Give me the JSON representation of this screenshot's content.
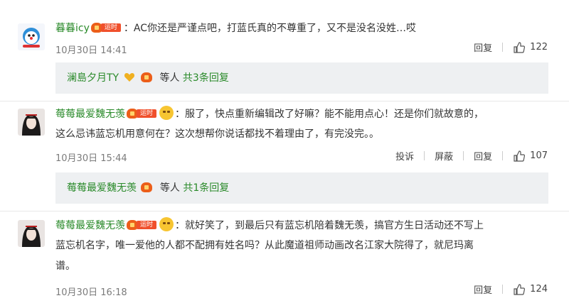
{
  "comments": [
    {
      "username": "暮暮icy",
      "badge": "运时",
      "text_lines": [
        "：AC你还是严谨点吧，打蓝氏真的不尊重了，又不是没名没姓…哎"
      ],
      "time": "10月30日 14:41",
      "reply": "回复",
      "likes": "122",
      "reply_preview": {
        "user": "澜島夕月TY",
        "mid": "等人",
        "count": "共3条回复"
      }
    },
    {
      "username": "莓莓最爱魏无羡",
      "badge": "运时",
      "text_lines": [
        "：服了，快点重新编辑改了好嘛？能不能用点心！还是你们就故意的，",
        "这么忌讳蓝忘机用意何在？这次想帮你说话都找不着理由了，有完没完。。"
      ],
      "time": "10月30日 15:44",
      "report": "投诉",
      "block": "屏蔽",
      "reply": "回复",
      "likes": "107",
      "reply_preview": {
        "user": "莓莓最爱魏无羡",
        "mid": "等人",
        "count": "共1条回复"
      }
    },
    {
      "username": "莓莓最爱魏无羡",
      "badge": "运时",
      "text_lines": [
        "：就好笑了，到最后只有蓝忘机陪着魏无羡，搞官方生日活动还不写上",
        "蓝忘机名字，唯一爱他的人都不配拥有姓名吗？从此魔道祖师动画改名江家大院得了，就尼玛离",
        "谱。"
      ],
      "time": "10月30日 16:18",
      "reply": "回复",
      "likes": "124"
    }
  ],
  "colors": {
    "username": "#2a8a2a",
    "meta": "#7b7b7b",
    "reply_bg": "#eef0f2"
  }
}
